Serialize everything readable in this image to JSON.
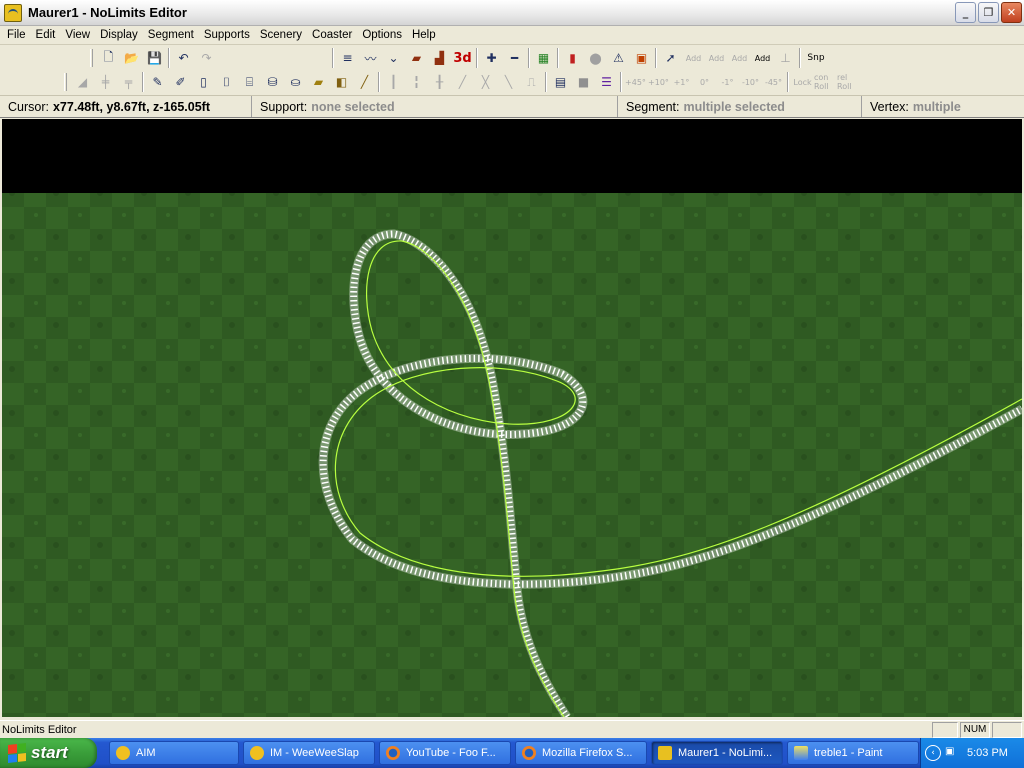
{
  "window": {
    "title": "Maurer1 - NoLimits Editor",
    "buttons": {
      "minimize": "_",
      "maximize": "❐",
      "close": "✕"
    }
  },
  "menu": [
    "File",
    "Edit",
    "View",
    "Display",
    "Segment",
    "Supports",
    "Scenery",
    "Coaster",
    "Options",
    "Help"
  ],
  "toolbar": {
    "snap_label": "Snp",
    "three_d_label": "3d",
    "rotate_labels": [
      "+45°",
      "+10°",
      "+1°",
      "0°",
      "-1°",
      "-10°",
      "-45°"
    ],
    "roll_labels": [
      "Lock",
      "con Roll",
      "rel Roll"
    ]
  },
  "infobar": {
    "cursor_label": "Cursor:",
    "cursor_value": "x77.48ft, y8.67ft, z-165.05ft",
    "support_label": "Support:",
    "support_value": "none selected",
    "segment_label": "Segment:",
    "segment_value": "multiple selected",
    "vertex_label": "Vertex:",
    "vertex_value": "multiple"
  },
  "viewport": {
    "sky_color": "#000000",
    "ground_color": "#2f5a22",
    "track_color": "#ffffff",
    "spine_color": "#b8ff40"
  },
  "statusbar": {
    "text": "NoLimits Editor",
    "num": "NUM"
  },
  "taskbar": {
    "start": "start",
    "tasks": [
      {
        "label": "AIM",
        "icon": "aim-icon",
        "active": false
      },
      {
        "label": "IM - WeeWeeSlap",
        "icon": "aim-icon",
        "active": false
      },
      {
        "label": "YouTube - Foo F...",
        "icon": "firefox-icon",
        "active": false
      },
      {
        "label": "Mozilla Firefox S...",
        "icon": "firefox-icon",
        "active": false
      },
      {
        "label": "Maurer1 - NoLimi...",
        "icon": "nolimits-icon",
        "active": true
      },
      {
        "label": "treble1 - Paint",
        "icon": "paint-icon",
        "active": false
      }
    ],
    "clock": "5:03 PM"
  }
}
